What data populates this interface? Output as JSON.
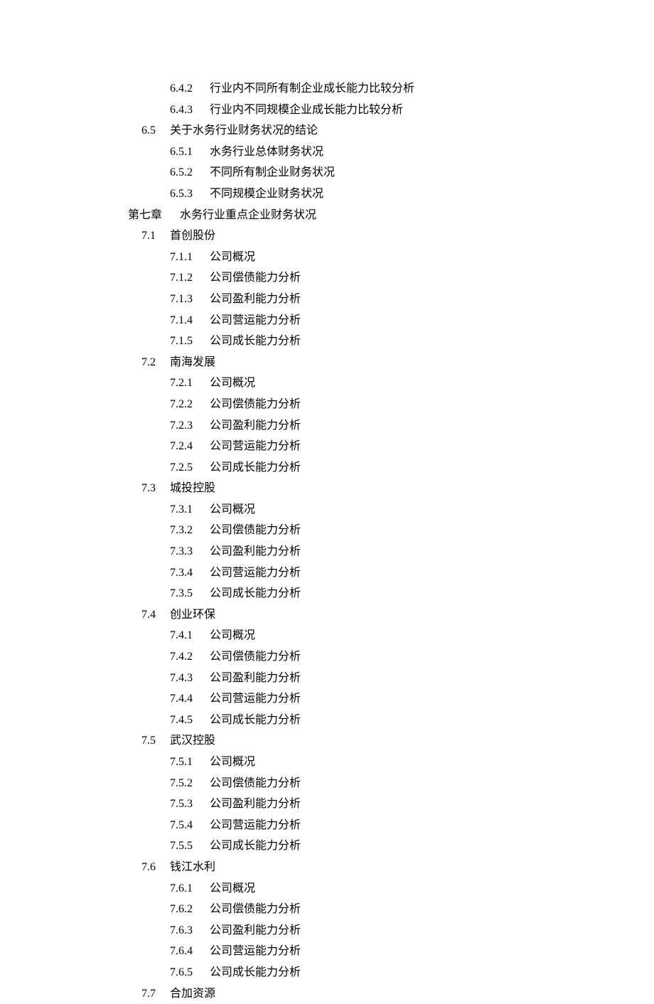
{
  "toc": [
    {
      "level": 3,
      "num": "6.4.2",
      "text": "行业内不同所有制企业成长能力比较分析"
    },
    {
      "level": 3,
      "num": "6.4.3",
      "text": "行业内不同规模企业成长能力比较分析"
    },
    {
      "level": 2,
      "num": "6.5",
      "text": "关于水务行业财务状况的结论"
    },
    {
      "level": 3,
      "num": "6.5.1",
      "text": "水务行业总体财务状况"
    },
    {
      "level": 3,
      "num": "6.5.2",
      "text": "不同所有制企业财务状况"
    },
    {
      "level": 3,
      "num": "6.5.3",
      "text": "不同规模企业财务状况"
    },
    {
      "level": 1,
      "num": "第七章",
      "text": "水务行业重点企业财务状况"
    },
    {
      "level": 2,
      "num": "7.1",
      "text": "首创股份"
    },
    {
      "level": 3,
      "num": "7.1.1",
      "text": "公司概况"
    },
    {
      "level": 3,
      "num": "7.1.2",
      "text": "公司偿债能力分析"
    },
    {
      "level": 3,
      "num": "7.1.3",
      "text": "公司盈利能力分析"
    },
    {
      "level": 3,
      "num": "7.1.4",
      "text": "公司营运能力分析"
    },
    {
      "level": 3,
      "num": "7.1.5",
      "text": "公司成长能力分析"
    },
    {
      "level": 2,
      "num": "7.2",
      "text": "南海发展"
    },
    {
      "level": 3,
      "num": "7.2.1",
      "text": "公司概况"
    },
    {
      "level": 3,
      "num": "7.2.2",
      "text": "公司偿债能力分析"
    },
    {
      "level": 3,
      "num": "7.2.3",
      "text": "公司盈利能力分析"
    },
    {
      "level": 3,
      "num": "7.2.4",
      "text": "公司营运能力分析"
    },
    {
      "level": 3,
      "num": "7.2.5",
      "text": "公司成长能力分析"
    },
    {
      "level": 2,
      "num": "7.3",
      "text": "城投控股"
    },
    {
      "level": 3,
      "num": "7.3.1",
      "text": "公司概况"
    },
    {
      "level": 3,
      "num": "7.3.2",
      "text": "公司偿债能力分析"
    },
    {
      "level": 3,
      "num": "7.3.3",
      "text": "公司盈利能力分析"
    },
    {
      "level": 3,
      "num": "7.3.4",
      "text": "公司营运能力分析"
    },
    {
      "level": 3,
      "num": "7.3.5",
      "text": "公司成长能力分析"
    },
    {
      "level": 2,
      "num": "7.4",
      "text": "创业环保"
    },
    {
      "level": 3,
      "num": "7.4.1",
      "text": "公司概况"
    },
    {
      "level": 3,
      "num": "7.4.2",
      "text": "公司偿债能力分析"
    },
    {
      "level": 3,
      "num": "7.4.3",
      "text": "公司盈利能力分析"
    },
    {
      "level": 3,
      "num": "7.4.4",
      "text": "公司营运能力分析"
    },
    {
      "level": 3,
      "num": "7.4.5",
      "text": "公司成长能力分析"
    },
    {
      "level": 2,
      "num": "7.5",
      "text": "武汉控股"
    },
    {
      "level": 3,
      "num": "7.5.1",
      "text": "公司概况"
    },
    {
      "level": 3,
      "num": "7.5.2",
      "text": "公司偿债能力分析"
    },
    {
      "level": 3,
      "num": "7.5.3",
      "text": "公司盈利能力分析"
    },
    {
      "level": 3,
      "num": "7.5.4",
      "text": "公司营运能力分析"
    },
    {
      "level": 3,
      "num": "7.5.5",
      "text": "公司成长能力分析"
    },
    {
      "level": 2,
      "num": "7.6",
      "text": "钱江水利"
    },
    {
      "level": 3,
      "num": "7.6.1",
      "text": "公司概况"
    },
    {
      "level": 3,
      "num": "7.6.2",
      "text": "公司偿债能力分析"
    },
    {
      "level": 3,
      "num": "7.6.3",
      "text": "公司盈利能力分析"
    },
    {
      "level": 3,
      "num": "7.6.4",
      "text": "公司营运能力分析"
    },
    {
      "level": 3,
      "num": "7.6.5",
      "text": "公司成长能力分析"
    },
    {
      "level": 2,
      "num": "7.7",
      "text": "合加资源"
    }
  ]
}
